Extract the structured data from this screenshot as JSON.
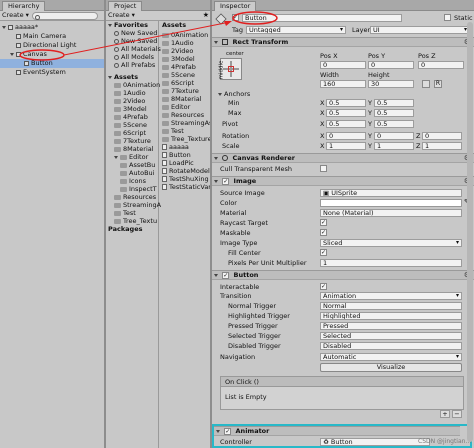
{
  "hierarchy": {
    "tab": "Hierarchy",
    "create": "Create ▾",
    "search_placeholder": "",
    "items": [
      {
        "label": "aaaaa*",
        "depth": 0,
        "kind": "scene",
        "expanded": true
      },
      {
        "label": "Main Camera",
        "depth": 1,
        "kind": "go"
      },
      {
        "label": "Directional Light",
        "depth": 1,
        "kind": "go"
      },
      {
        "label": "Canvas",
        "depth": 1,
        "kind": "go",
        "expanded": true
      },
      {
        "label": "Button",
        "depth": 2,
        "kind": "go",
        "selected": true
      },
      {
        "label": "EventSystem",
        "depth": 1,
        "kind": "go"
      }
    ]
  },
  "project": {
    "tab": "Project",
    "create": "Create ▾",
    "favorites_label": "Favorites",
    "favorites": [
      "New Saved",
      "New Saved",
      "All Materials",
      "All Models",
      "All Prefabs"
    ],
    "assets_label": "Assets",
    "tree": [
      {
        "label": "0Animation",
        "depth": 1
      },
      {
        "label": "1Audio",
        "depth": 1
      },
      {
        "label": "2Video",
        "depth": 1
      },
      {
        "label": "3Model",
        "depth": 1
      },
      {
        "label": "4Prefab",
        "depth": 1
      },
      {
        "label": "5Scene",
        "depth": 1
      },
      {
        "label": "6Script",
        "depth": 1
      },
      {
        "label": "7Texture",
        "depth": 1
      },
      {
        "label": "8Material",
        "depth": 1
      },
      {
        "label": "Editor",
        "depth": 1,
        "expanded": true
      },
      {
        "label": "AssetBu",
        "depth": 2
      },
      {
        "label": "AutoBui",
        "depth": 2
      },
      {
        "label": "Icons",
        "depth": 2
      },
      {
        "label": "InspectT",
        "depth": 2
      },
      {
        "label": "Resources",
        "depth": 1
      },
      {
        "label": "StreamingA",
        "depth": 1
      },
      {
        "label": "Test",
        "depth": 1
      },
      {
        "label": "Tree_Textu",
        "depth": 1
      }
    ],
    "packages_label": "Packages",
    "right_header": "Assets",
    "files": [
      {
        "label": "0Animation",
        "kind": "folder"
      },
      {
        "label": "1Audio",
        "kind": "folder"
      },
      {
        "label": "2Video",
        "kind": "folder"
      },
      {
        "label": "3Model",
        "kind": "folder"
      },
      {
        "label": "4Prefab",
        "kind": "folder"
      },
      {
        "label": "5Scene",
        "kind": "folder"
      },
      {
        "label": "6Script",
        "kind": "folder"
      },
      {
        "label": "7Texture",
        "kind": "folder"
      },
      {
        "label": "8Material",
        "kind": "folder"
      },
      {
        "label": "Editor",
        "kind": "folder"
      },
      {
        "label": "Resources",
        "kind": "folder"
      },
      {
        "label": "StreamingAssets",
        "kind": "folder"
      },
      {
        "label": "Test",
        "kind": "folder"
      },
      {
        "label": "Tree_Textures",
        "kind": "folder"
      },
      {
        "label": "aaaaa",
        "kind": "file"
      },
      {
        "label": "Button",
        "kind": "file"
      },
      {
        "label": "LoadPic",
        "kind": "file"
      },
      {
        "label": "RotateModel",
        "kind": "file"
      },
      {
        "label": "TestShuXing",
        "kind": "file"
      },
      {
        "label": "TestStaticVaria",
        "kind": "file"
      }
    ]
  },
  "inspector": {
    "tab": "Inspector",
    "name": "Button",
    "static_label": "Static ▾",
    "tag_label": "Tag",
    "tag_value": "Untagged",
    "layer_label": "Layer",
    "layer_value": "UI",
    "rect": {
      "title": "Rect Transform",
      "anchor_h": "center",
      "anchor_v": "middle",
      "col_x": "Pos X",
      "col_y": "Pos Y",
      "col_z": "Pos Z",
      "pos_x": "0",
      "pos_y": "0",
      "pos_z": "0",
      "col_w": "Width",
      "col_h": "Height",
      "width": "160",
      "height": "30",
      "anchors_label": "Anchors",
      "min_label": "Min",
      "max_label": "Max",
      "pivot_label": "Pivot",
      "rotation_label": "Rotation",
      "scale_label": "Scale",
      "x_lbl": "X",
      "y_lbl": "Y",
      "z_lbl": "Z",
      "min_x": "0.5",
      "min_y": "0.5",
      "max_x": "0.5",
      "max_y": "0.5",
      "pivot_x": "0.5",
      "pivot_y": "0.5",
      "rot_x": "0",
      "rot_y": "0",
      "rot_z": "0",
      "scale_x": "1",
      "scale_y": "1",
      "scale_z": "1"
    },
    "canvas_renderer": {
      "title": "Canvas Renderer",
      "cull_label": "Cull Transparent Mesh"
    },
    "image": {
      "title": "Image",
      "source_label": "Source Image",
      "source_value": "UISprite",
      "color_label": "Color",
      "material_label": "Material",
      "material_value": "None (Material)",
      "raycast_label": "Raycast Target",
      "maskable_label": "Maskable",
      "type_label": "Image Type",
      "type_value": "Sliced",
      "fill_label": "Fill Center",
      "ppu_label": "Pixels Per Unit Multiplier",
      "ppu_value": "1"
    },
    "button": {
      "title": "Button",
      "interactable_label": "Interactable",
      "transition_label": "Transition",
      "transition_value": "Animation",
      "normal_label": "Normal Trigger",
      "normal_value": "Normal",
      "highlighted_label": "Highlighted Trigger",
      "highlighted_value": "Highlighted",
      "pressed_label": "Pressed Trigger",
      "pressed_value": "Pressed",
      "selected_label": "Selected Trigger",
      "selected_value": "Selected",
      "disabled_label": "Disabled Trigger",
      "disabled_value": "Disabled",
      "navigation_label": "Navigation",
      "navigation_value": "Automatic",
      "visualize_label": "Visualize",
      "onclick_label": "On Click ()",
      "list_empty": "List is Empty"
    },
    "animator": {
      "title": "Animator",
      "controller_label": "Controller",
      "controller_value": "Button"
    },
    "watermark": "CSDN @jingtian…"
  },
  "colors": {
    "annotation_red": "#e02020",
    "highlight_teal": "#28b8c8",
    "selection_blue": "#8fb1de"
  }
}
